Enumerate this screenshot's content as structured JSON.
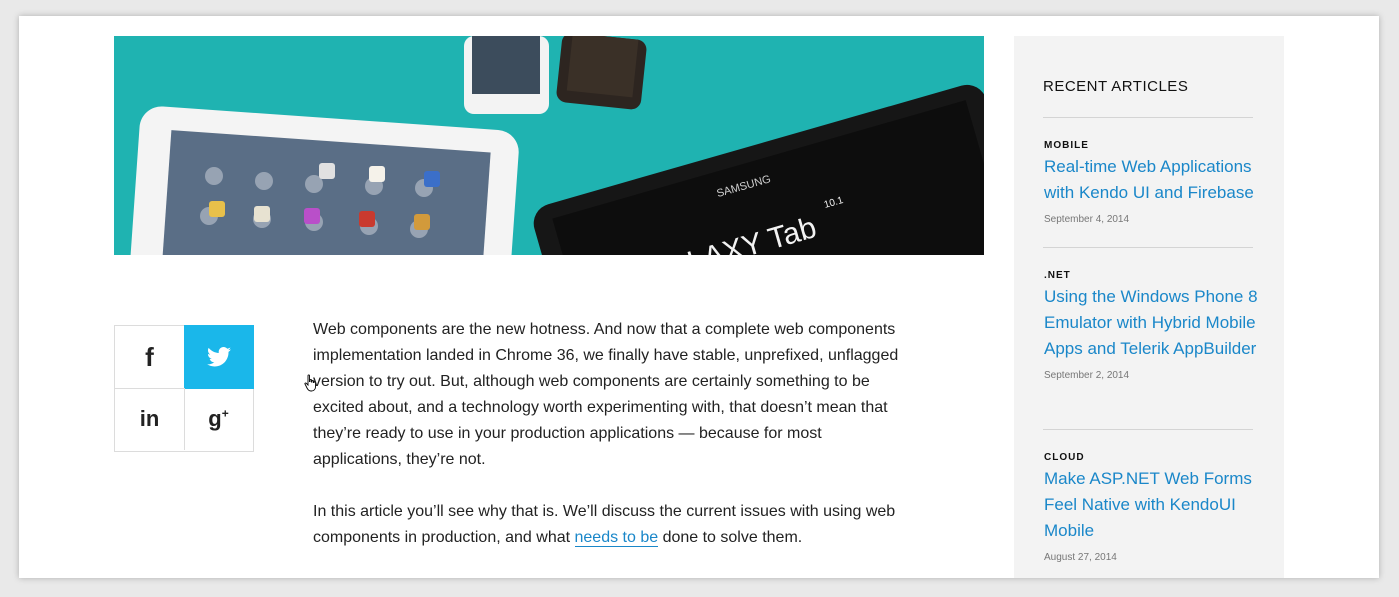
{
  "share": {
    "facebook_label": "f",
    "twitter_icon": "twitter-bird-icon",
    "linkedin_label": "in",
    "googleplus_label": "g",
    "googleplus_sup": "+",
    "twitter_color": "#1ab7ea"
  },
  "hero": {
    "device_brand": "SAMSUNG",
    "device_model": "GALAXY Tab",
    "device_size": "10.1"
  },
  "article": {
    "p1": "Web components are the new hotness. And now that a complete web components implementation landed in Chrome 36, we finally have stable, unprefixed, unflagged version to try out. But, although web components are certainly something to be excited about, and a technology worth experimenting with, that doesn’t mean that they’re ready to use in your production applications — because for most applications, they’re not.",
    "p2_before": "In this article you’ll see why that is. We’ll discuss the current issues with using web components in production, and what ",
    "p2_link": "needs to be",
    "p2_after": " done to solve them."
  },
  "sidebar": {
    "heading": "RECENT ARTICLES",
    "items": [
      {
        "category": "MOBILE",
        "title": "Real-time Web Applications with Kendo UI and Firebase",
        "date": "September 4, 2014"
      },
      {
        "category": ".NET",
        "title": "Using the Windows Phone 8 Emulator with Hybrid Mobile Apps and Telerik AppBuilder",
        "date": "September 2, 2014"
      },
      {
        "category": "CLOUD",
        "title": "Make ASP.NET Web Forms Feel Native with KendoUI Mobile",
        "date": "August 27, 2014"
      }
    ]
  },
  "colors": {
    "link": "#1a87c9",
    "sidebar_bg": "#f3f3f3",
    "hero_bg": "#1fb5b3"
  }
}
